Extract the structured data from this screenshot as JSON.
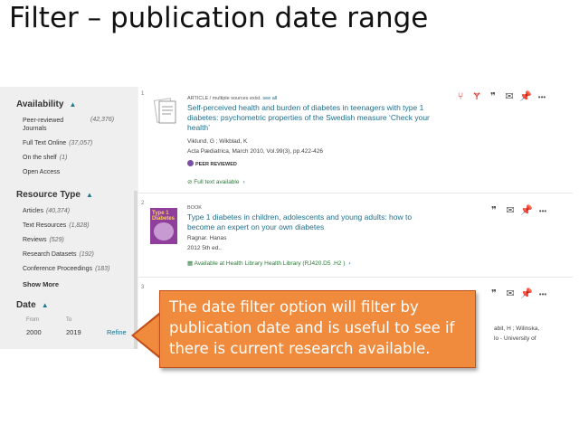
{
  "slide": {
    "title": "Filter – publication date range"
  },
  "sidebar": {
    "availability": {
      "heading": "Availability",
      "items": [
        {
          "label": "Peer-reviewed",
          "label2": "Journals",
          "count": "(42,376)"
        },
        {
          "label": "Full Text Online",
          "count": "(37,057)"
        },
        {
          "label": "On the shelf",
          "count": "(1)"
        },
        {
          "label": "Open Access",
          "count": ""
        }
      ]
    },
    "resource_type": {
      "heading": "Resource Type",
      "items": [
        {
          "label": "Articles",
          "count": "(40,374)"
        },
        {
          "label": "Text Resources",
          "count": "(1,828)"
        },
        {
          "label": "Reviews",
          "count": "(529)"
        },
        {
          "label": "Research Datasets",
          "count": "(192)"
        },
        {
          "label": "Conference Proceedings",
          "count": "(183)"
        }
      ],
      "show_more": "Show More"
    },
    "date": {
      "heading": "Date",
      "from_label": "From",
      "to_label": "To",
      "from_value": "2000",
      "to_value": "2019",
      "refine": "Refine"
    }
  },
  "results": [
    {
      "index": "1",
      "type": "ARTICLE",
      "type_extra": "/ multiple sources exist.",
      "see_all": "see all",
      "title_line1": "Self-perceived health and burden of diabetes in teenagers with type 1",
      "title_line2": "diabetes: psychometric properties of the Swedish measure ‘Check your",
      "title_line3": "health’",
      "authors": "Viklund, G ; Wikblad, K",
      "source": "Acta Pædiatrica, March 2010, Vol.99(3), pp.422-426",
      "badge": "PEER REVIEWED",
      "availability": "Full text available",
      "arrow": "›"
    },
    {
      "index": "2",
      "type": "BOOK",
      "cover_text": "Type 1 Diabetes",
      "title_line1": "Type 1 diabetes in children, adolescents and young adults: how to",
      "title_line2": "become an expert on your own diabetes",
      "authors": "Ragnar. Hanas",
      "source": "2012 5th ed..",
      "availability": "Available at Health Library  Health Library (RJ420.D5 .H2 )",
      "arrow": "›"
    },
    {
      "index": "3",
      "partial_line1": "abit, H ; Wilinska,",
      "partial_line2": "lo - University of"
    }
  ],
  "icons": {
    "cite": "❞",
    "email": "✉",
    "pin": "📌",
    "more": "•••"
  },
  "callout": {
    "text": "The date filter option will filter by publication date and is useful to see if there is current research available."
  },
  "colors": {
    "accent": "#1f6e8a",
    "callout": "#f08a3c",
    "action_red": "#d9241c"
  }
}
